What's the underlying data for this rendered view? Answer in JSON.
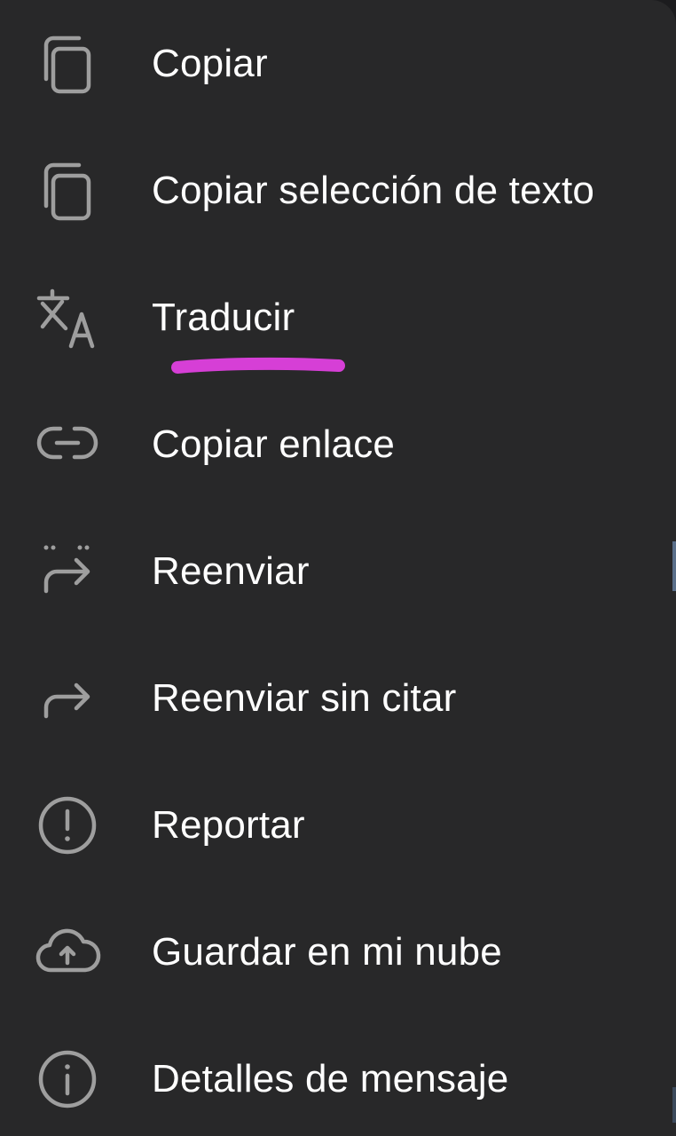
{
  "menu": {
    "items": [
      {
        "label": "Copiar",
        "icon": "copy-icon"
      },
      {
        "label": "Copiar selección de texto",
        "icon": "copy-selection-icon"
      },
      {
        "label": "Traducir",
        "icon": "translate-icon"
      },
      {
        "label": "Copiar enlace",
        "icon": "link-icon"
      },
      {
        "label": "Reenviar",
        "icon": "forward-icon"
      },
      {
        "label": "Reenviar sin citar",
        "icon": "forward-without-quote-icon"
      },
      {
        "label": "Reportar",
        "icon": "report-icon"
      },
      {
        "label": "Guardar en mi nube",
        "icon": "cloud-upload-icon"
      },
      {
        "label": "Detalles de mensaje",
        "icon": "info-icon"
      }
    ]
  },
  "colors": {
    "menu_background": "#282829",
    "text": "#ffffff",
    "icon": "#9e9e9e",
    "highlight_underline": "#d63fd6"
  }
}
